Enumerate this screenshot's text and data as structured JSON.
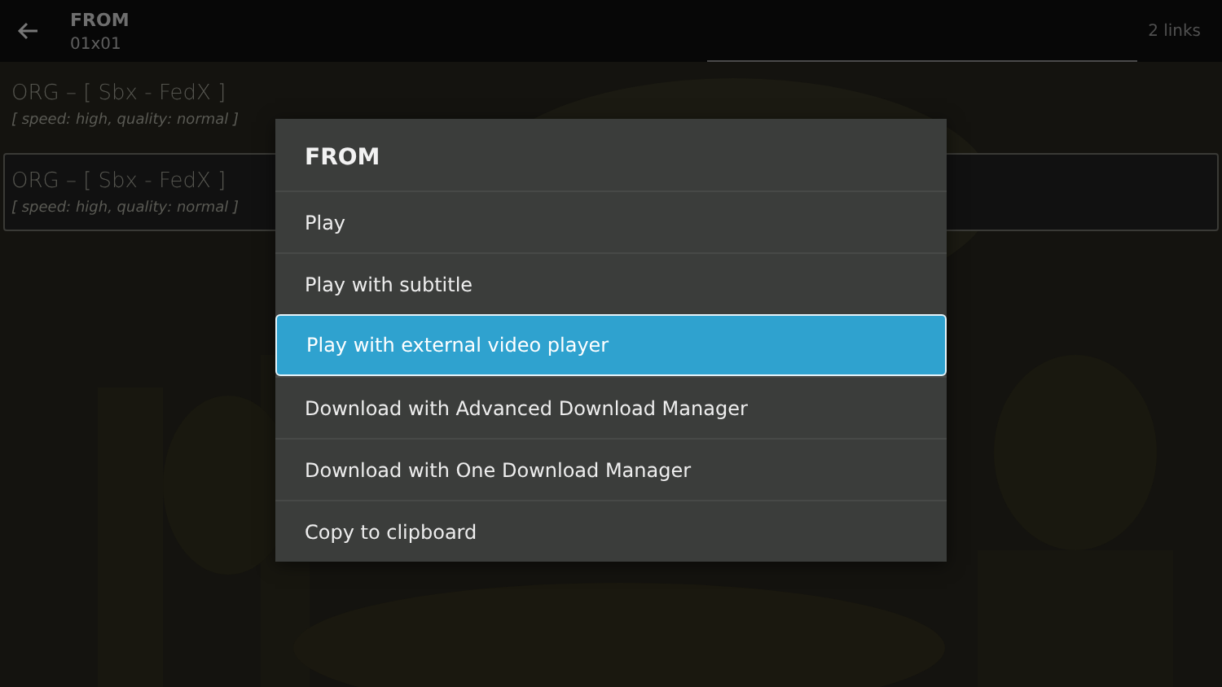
{
  "header": {
    "title": "FROM",
    "subtitle": "01x01",
    "count": "2 links"
  },
  "links": [
    {
      "name": "ORG – [ Sbx - FedX ]",
      "details": "[ speed: high, quality: normal ]",
      "selected": false
    },
    {
      "name": "ORG – [ Sbx - FedX ]",
      "details": "[ speed: high, quality: normal ]",
      "selected": true
    }
  ],
  "dialog": {
    "title": "FROM",
    "items": [
      {
        "label": "Play",
        "selected": false
      },
      {
        "label": "Play with subtitle",
        "selected": false
      },
      {
        "label": "Play with external video player",
        "selected": true
      },
      {
        "label": "Download with Advanced Download Manager",
        "selected": false
      },
      {
        "label": "Download with One Download Manager",
        "selected": false
      },
      {
        "label": "Copy to clipboard",
        "selected": false
      }
    ]
  }
}
